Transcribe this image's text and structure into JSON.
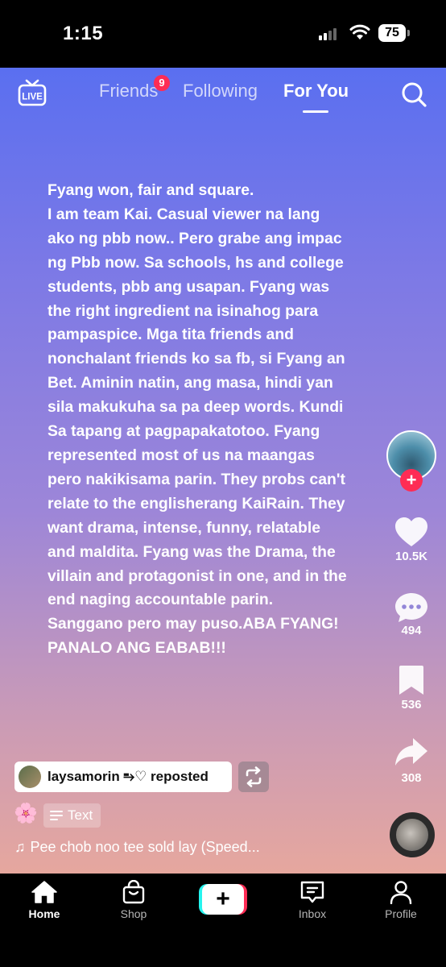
{
  "status_bar": {
    "time": "1:15",
    "battery": "75"
  },
  "top_nav": {
    "live_icon": "live-tv-icon",
    "tabs": [
      {
        "label": "Friends",
        "badge": "9"
      },
      {
        "label": "Following"
      },
      {
        "label": "For You",
        "active": true
      }
    ],
    "search_icon": "search-icon"
  },
  "caption_lines": [
    "Fyang won, fair and square.",
    "I am team Kai. Casual viewer na lang",
    "ako ng pbb now.. Pero grabe ang impac",
    "ng Pbb now. Sa schools, hs and college",
    "students, pbb ang usapan. Fyang was",
    "the right ingredient na isinahog para",
    "pampaspice. Mga tita friends and",
    "nonchalant friends ko sa fb, si Fyang an",
    "Bet. Aminin natin, ang masa, hindi yan",
    "sila makukuha sa pa deep words. Kundi",
    "Sa tapang at pagpapakatotoo. Fyang",
    "represented most of us na maangas",
    "pero nakikisama parin. They probs can't",
    "relate to the englisherang KaiRain. They",
    "want drama, intense, funny, relatable",
    "and maldita. Fyang was the Drama, the",
    "villain and protagonist in one, and in the",
    "end naging accountable parin.",
    "Sanggano pero may puso.ABA FYANG!",
    "PANALO ANG EABAB!!!"
  ],
  "rail": {
    "likes": "10.5K",
    "comments": "494",
    "saves": "536",
    "shares": "308"
  },
  "repost": {
    "text": "laysamorin ⥱♡ reposted"
  },
  "text_chip": {
    "emoji": "🌸",
    "label": "Text"
  },
  "music": {
    "note": "♫",
    "title": "Pee chob noo tee sold lay (Speed..."
  },
  "tab_bar": {
    "home": "Home",
    "shop": "Shop",
    "create": "+",
    "inbox": "Inbox",
    "profile": "Profile"
  },
  "colors": {
    "accent_red": "#fe2c55",
    "accent_cyan": "#25f4ee"
  }
}
